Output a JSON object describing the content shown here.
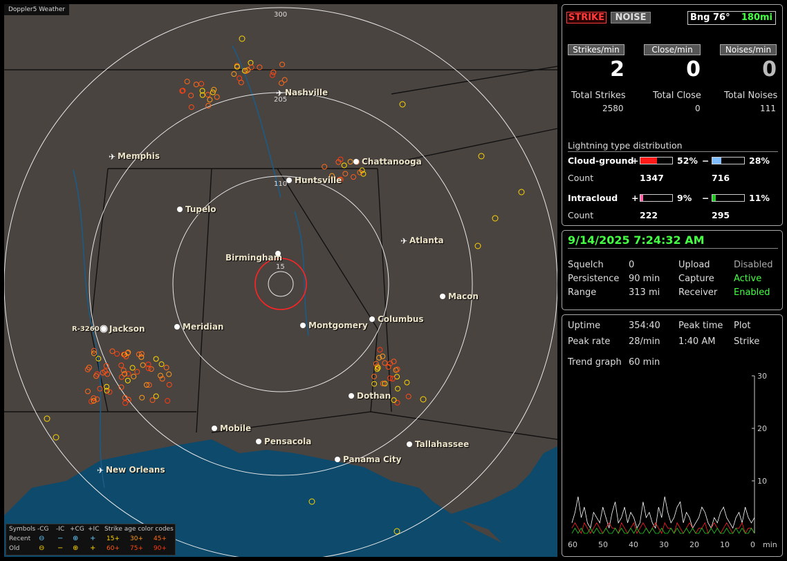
{
  "map": {
    "app_tag": "Doppler5 Weather",
    "ring_labels": [
      "300",
      "205",
      "110",
      "15"
    ],
    "cities": [
      {
        "name": "Nashville",
        "type": "airport"
      },
      {
        "name": "Memphis",
        "type": "airport"
      },
      {
        "name": "Chattanooga",
        "type": "city"
      },
      {
        "name": "Huntsville",
        "type": "city"
      },
      {
        "name": "Tupelo",
        "type": "city"
      },
      {
        "name": "Atlanta",
        "type": "airport"
      },
      {
        "name": "Birmingham",
        "type": "city"
      },
      {
        "name": "Macon",
        "type": "city"
      },
      {
        "name": "Jackson",
        "type": "city"
      },
      {
        "name": "Meridian",
        "type": "city"
      },
      {
        "name": "Montgomery",
        "type": "city"
      },
      {
        "name": "Columbus",
        "type": "city"
      },
      {
        "name": "Dothan",
        "type": "city"
      },
      {
        "name": "Mobile",
        "type": "city"
      },
      {
        "name": "Pensacola",
        "type": "city"
      },
      {
        "name": "Tallahassee",
        "type": "city"
      },
      {
        "name": "Panama City",
        "type": "city"
      },
      {
        "name": "New Orleans",
        "type": "airport"
      }
    ],
    "site_label": "R-3260",
    "legend": {
      "symbols_title": "Symbols",
      "headers": [
        "-CG",
        "-IC",
        "+CG",
        "+IC"
      ],
      "recent_label": "Recent",
      "old_label": "Old",
      "age_title": "Strike age color codes",
      "recent_ages": [
        "15+",
        "30+",
        "45+"
      ],
      "old_ages": [
        "60+",
        "75+",
        "90+"
      ],
      "age_colors": [
        "#ffd700",
        "#ff9a1a",
        "#ff6a1a",
        "#ff5a1a",
        "#ff4a10",
        "#ff3a10"
      ]
    }
  },
  "panel_counts": {
    "strike_button": "STRIKE",
    "noise_button": "NOISE",
    "bearing_label": "Bng 76°",
    "range_label": "180mi",
    "rates": [
      {
        "tab": "Strikes/min",
        "value": "2",
        "total_label": "Total Strikes",
        "total": "2580"
      },
      {
        "tab": "Close/min",
        "value": "0",
        "total_label": "Total Close",
        "total": "0"
      },
      {
        "tab": "Noises/min",
        "value": "0",
        "total_label": "Total Noises",
        "total": "111"
      }
    ],
    "distribution_title": "Lightning type distribution",
    "cloud_ground": {
      "label": "Cloud-ground",
      "pos_pct": "52%",
      "neg_pct": "28%",
      "count_label": "Count",
      "pos_count": "1347",
      "neg_count": "716",
      "pos_fill": 0.52,
      "neg_fill": 0.28
    },
    "intracloud": {
      "label": "Intracloud",
      "pos_pct": "9%",
      "neg_pct": "11%",
      "count_label": "Count",
      "pos_count": "222",
      "neg_count": "295",
      "pos_fill": 0.09,
      "neg_fill": 0.11
    },
    "colors": {
      "cg_pos": "#ff1a1a",
      "cg_neg": "#7fbfff",
      "ic_pos": "#ff66aa",
      "ic_neg": "#22cc22"
    }
  },
  "panel_status": {
    "datetime": "9/14/2025 7:24:32 AM",
    "rows": [
      {
        "k1": "Squelch",
        "v1": "0",
        "k2": "Upload",
        "v2": "Disabled",
        "v2_state": "off"
      },
      {
        "k1": "Persistence",
        "v1": "90 min",
        "k2": "Capture",
        "v2": "Active",
        "v2_state": "on"
      },
      {
        "k1": "Range",
        "v1": "313 mi",
        "k2": "Receiver",
        "v2": "Enabled",
        "v2_state": "on"
      }
    ]
  },
  "panel_trend": {
    "uptime_label": "Uptime",
    "uptime": "354:40",
    "peak_time_label": "Peak time",
    "plot_label": "Plot",
    "peak_rate_label": "Peak rate",
    "peak_rate": "28/min",
    "peak_time": "1:40 AM",
    "plot_value": "Strike",
    "trend_label": "Trend graph",
    "trend_value": "60 min",
    "chart_data": {
      "type": "line",
      "x_ticks": [
        "60",
        "50",
        "40",
        "30",
        "20",
        "10",
        "0"
      ],
      "x_unit": "min",
      "y_ticks": [
        "30",
        "20",
        "10"
      ],
      "ylim": [
        0,
        30
      ],
      "series": [
        {
          "color": "#ffffff",
          "values": [
            2,
            4,
            7,
            3,
            5,
            2,
            1,
            4,
            3,
            2,
            5,
            3,
            1,
            4,
            6,
            2,
            3,
            5,
            2,
            4,
            3,
            1,
            2,
            6,
            3,
            4,
            2,
            1,
            5,
            3,
            7,
            4,
            2,
            3,
            5,
            6,
            2,
            4,
            3,
            1,
            2,
            3,
            5,
            4,
            2,
            1,
            3,
            2,
            4,
            5,
            3,
            2,
            1,
            3,
            4,
            2,
            5,
            3,
            2,
            3
          ]
        },
        {
          "color": "#ff2222",
          "values": [
            1,
            2,
            1,
            0,
            2,
            1,
            0,
            1,
            2,
            1,
            0,
            1,
            2,
            1,
            1,
            0,
            2,
            1,
            0,
            1,
            2,
            0,
            1,
            2,
            1,
            0,
            1,
            2,
            1,
            0,
            2,
            1,
            1,
            0,
            2,
            1,
            0,
            1,
            2,
            1,
            0,
            1,
            1,
            2,
            0,
            1,
            2,
            1,
            0,
            1,
            2,
            1,
            0,
            1,
            1,
            2,
            0,
            1,
            1,
            0
          ]
        },
        {
          "color": "#22cc22",
          "values": [
            0,
            1,
            0,
            1,
            0,
            0,
            1,
            0,
            1,
            0,
            0,
            1,
            0,
            0,
            1,
            0,
            1,
            0,
            0,
            1,
            0,
            1,
            0,
            0,
            1,
            0,
            1,
            0,
            0,
            1,
            0,
            0,
            1,
            0,
            1,
            0,
            0,
            1,
            0,
            1,
            0,
            0,
            1,
            0,
            0,
            1,
            0,
            1,
            0,
            0,
            1,
            0,
            0,
            1,
            0,
            1,
            0,
            0,
            1,
            0
          ]
        }
      ]
    }
  }
}
